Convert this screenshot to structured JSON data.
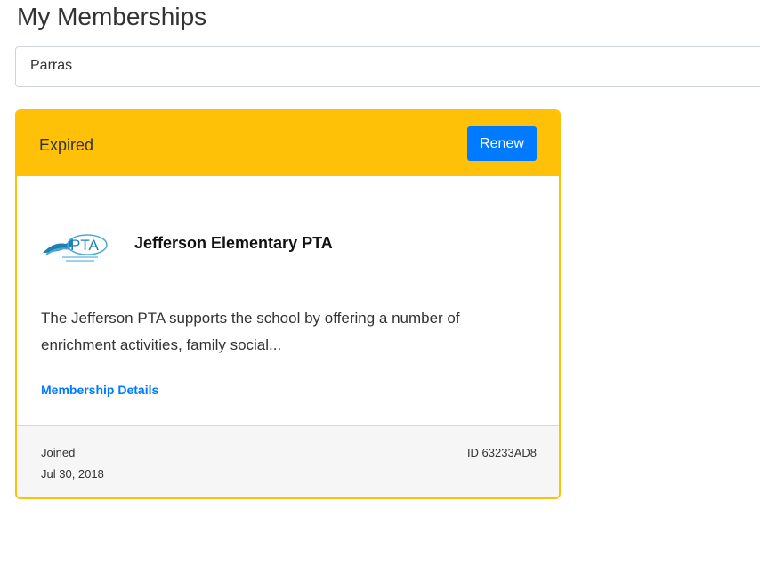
{
  "page": {
    "title": "My Memberships"
  },
  "filter": {
    "selected": "Parras"
  },
  "membership": {
    "status": "Expired",
    "renew_label": "Renew",
    "logo_text": "PTA",
    "logo_icon": "pta-logo-icon",
    "org_name": "Jefferson Elementary PTA",
    "description": "The Jefferson PTA supports the school by offering a number of enrichment activities, family social...",
    "details_link": "Membership Details",
    "joined_label": "Joined",
    "joined_date": "Jul 30, 2018",
    "member_id": "ID 63233AD8",
    "status_color": "#ffc107",
    "accent_color": "#007bff"
  }
}
